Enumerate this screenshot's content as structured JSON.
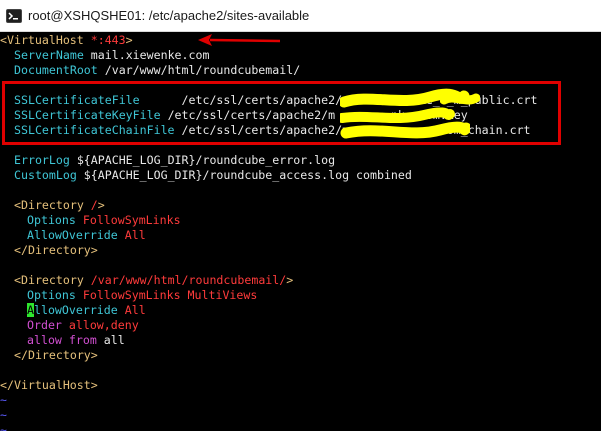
{
  "window": {
    "title": "root@XSHQSHE01: /etc/apache2/sites-available",
    "icon": "terminal-icon"
  },
  "colors": {
    "tag": "#e5c07b",
    "directive": "#3fc6d6",
    "value": "#e8e8e8",
    "red_value": "#ff3b3b",
    "magenta": "#d14fd1",
    "tilde": "#5c5cff",
    "annotation": "#e00000",
    "redaction": "#ffff00"
  },
  "config": {
    "vhost_open": {
      "tag": "<VirtualHost",
      "arg": " *:443",
      "close": ">"
    },
    "server_name": {
      "key": "ServerName",
      "value": " mail.xiewenke.com"
    },
    "document_root": {
      "key": "DocumentRoot",
      "value": " /var/www/html/roundcubemail/"
    },
    "ssl_cert": {
      "key": "SSLCertificateFile",
      "value": "      /etc/ssl/certs/apache2/m          ke_c_m_public.crt"
    },
    "ssl_key": {
      "key": "SSLCertificateKeyFile",
      "value": " /etc/ssl/certs/apache2/m        nke.com.key"
    },
    "ssl_chain": {
      "key": "SSLCertificateChainFile",
      "value": " /etc/ssl/certs/apache2/m              om_chain.crt"
    },
    "error_log": {
      "key": "ErrorLog",
      "value": " ${APACHE_LOG_DIR}/roundcube_error.log"
    },
    "custom_log": {
      "key": "CustomLog",
      "value": " ${APACHE_LOG_DIR}/roundcube_access.log combined"
    },
    "dir1_open": {
      "tag": "<Directory",
      "arg": " /",
      "close": ">"
    },
    "dir1_options": {
      "key": "Options",
      "value": " FollowSymLinks"
    },
    "dir1_override": {
      "key": "AllowOverride",
      "value": " All"
    },
    "dir1_close": {
      "tag": "</Directory>"
    },
    "dir2_open": {
      "tag": "<Directory",
      "arg": " /var/www/html/roundcubemail/",
      "close": ">"
    },
    "dir2_options": {
      "key": "Options",
      "value": " FollowSymLinks MultiViews"
    },
    "dir2_override": {
      "cursor": "A",
      "key": "llowOverride",
      "value": " All"
    },
    "dir2_order": {
      "key": "Order",
      "value": " allow,deny"
    },
    "dir2_allow": {
      "key": "allow",
      "from": " from",
      "value": " all"
    },
    "dir2_close": {
      "tag": "</Directory>"
    },
    "vhost_close": {
      "tag": "</VirtualHost>"
    },
    "tilde": "~"
  }
}
